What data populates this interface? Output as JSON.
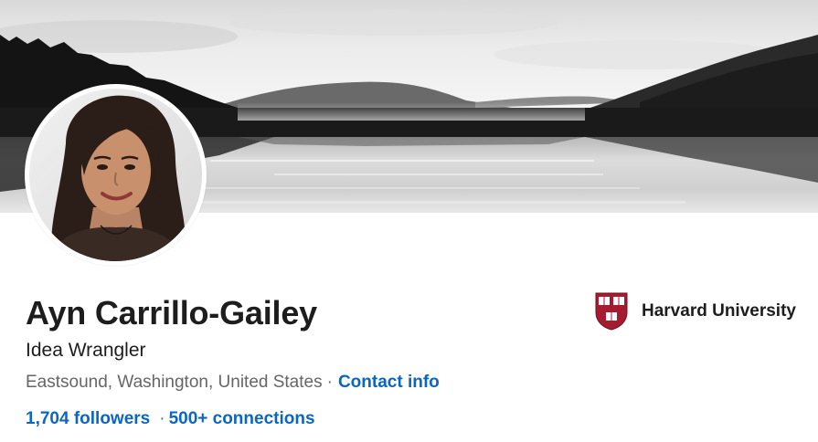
{
  "profile": {
    "name": "Ayn Carrillo-Gailey",
    "headline": "Idea Wrangler",
    "location": "Eastsound, Washington, United States",
    "location_separator": "·",
    "contact_info": "Contact info",
    "followers": "1,704 followers",
    "stats_separator": "·",
    "connections": "500+ connections"
  },
  "education": {
    "school": "Harvard University",
    "crest_icon": "harvard-shield-icon"
  },
  "colors": {
    "link": "#0a66c2",
    "text_primary": "#1d1d1d",
    "text_secondary": "#666666",
    "crest_red": "#a51c30"
  }
}
